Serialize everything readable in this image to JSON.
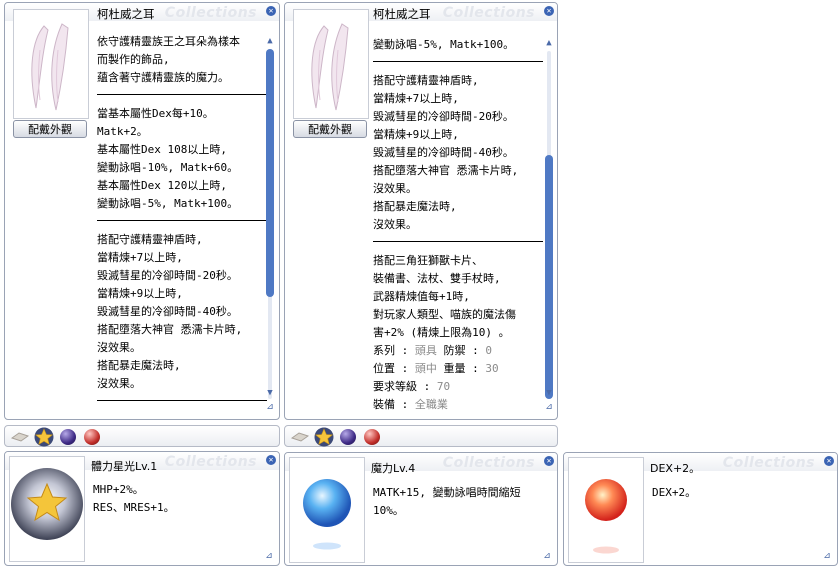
{
  "watermark": "Collections",
  "left_panel": {
    "title": "柯杜威之耳",
    "preview_button": "配戴外觀",
    "lines": [
      "依守護精靈族王之耳朵為樣本",
      "而製作的飾品,",
      "蘊含著守護精靈族的魔力。",
      "---",
      "當基本屬性Dex每+10。",
      "Matk+2。",
      "基本屬性Dex 108以上時,",
      "變動詠唱-10%, Matk+60。",
      "基本屬性Dex 120以上時,",
      "變動詠唱-5%, Matk+100。",
      "---",
      "搭配守護精靈神盾時,",
      "當精煉+7以上時,",
      "毀滅彗星的冷卻時間-20秒。",
      "當精煉+9以上時,",
      "毀滅彗星的冷卻時間-40秒。",
      "搭配墮落大神官 悉濡卡片時,",
      "沒效果。",
      "搭配暴走魔法時,",
      "沒效果。",
      "---"
    ]
  },
  "right_panel": {
    "title": "柯杜威之耳",
    "preview_button": "配戴外觀",
    "lines": [
      "變動詠唱-5%, Matk+100。",
      "---",
      "搭配守護精靈神盾時,",
      "當精煉+7以上時,",
      "毀滅彗星的冷卻時間-20秒。",
      "當精煉+9以上時,",
      "毀滅彗星的冷卻時間-40秒。",
      "搭配墮落大神官 悉濡卡片時,",
      "沒效果。",
      "搭配暴走魔法時,",
      "沒效果。",
      "---",
      "搭配三角狂獅獸卡片、",
      "裝備書、法杖、雙手杖時,",
      "武器精煉值每+1時,",
      "對玩家人類型、喵族的魔法傷",
      "害+2% (精煉上限為10) 。"
    ],
    "stats": {
      "type_label": "系列 :",
      "type_value": "頭具",
      "defense_label": "防禦 :",
      "defense_value": "0",
      "position_label": "位置 :",
      "position_value": "頭中",
      "weight_label": "重量 :",
      "weight_value": "30",
      "level_label": "要求等級 :",
      "level_value": "70",
      "equip_label": "裝備 :",
      "equip_value": "全職業"
    }
  },
  "cards": [
    {
      "name": "體力星光Lv.1",
      "lines": [
        "MHP+2%。",
        "RES、MRES+1。"
      ]
    },
    {
      "name": "魔力Lv.4",
      "lines": [
        "MATK+15, 變動詠唱時間縮短",
        "10%。"
      ]
    },
    {
      "name": "DEX+2。",
      "lines": [
        "DEX+2。"
      ]
    }
  ],
  "colors": {
    "scroll_thumb": "#4f79c4",
    "border": "#9aa3b5",
    "stat_value": "#8a8a8a"
  }
}
